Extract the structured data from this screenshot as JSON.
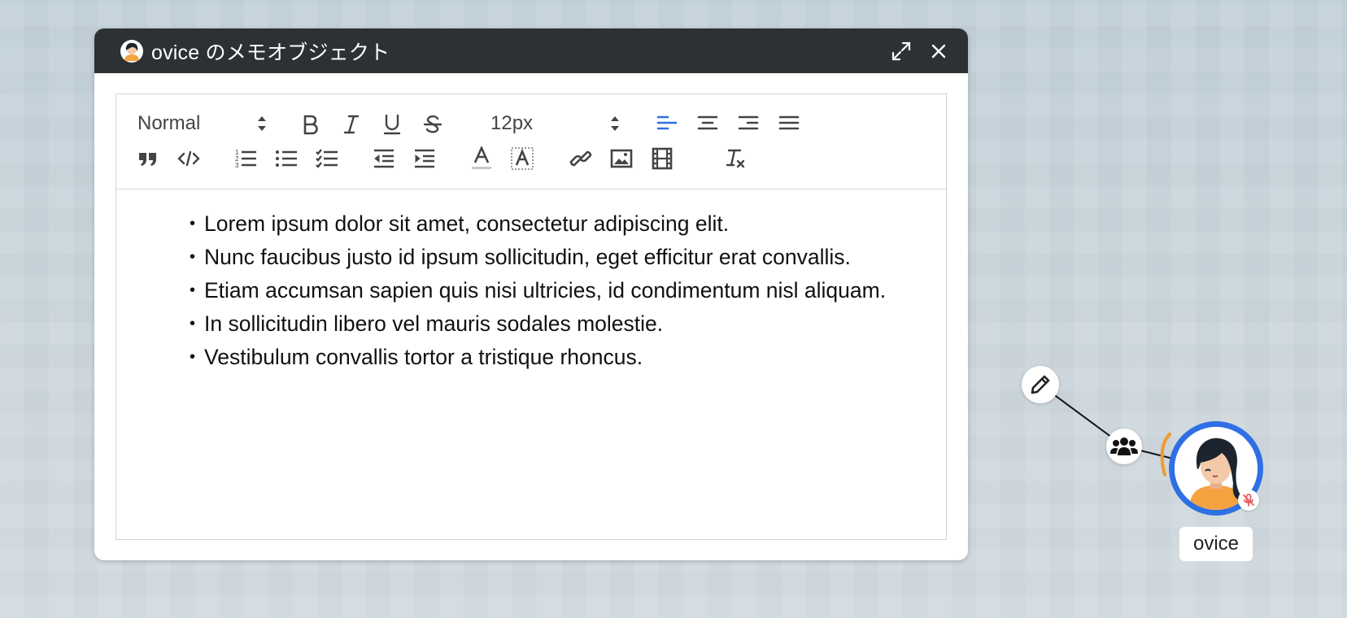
{
  "window": {
    "title": "ovice のメモオブジェクト",
    "title_icon": "avatar-icon",
    "expand_icon": "expand-icon",
    "close_icon": "close-icon"
  },
  "toolbar": {
    "heading_select": "Normal",
    "size_select": "12px",
    "row1_icons": [
      "bold-icon",
      "italic-icon",
      "underline-icon",
      "strike-icon",
      "align-left-icon",
      "align-center-icon",
      "align-right-icon",
      "align-justify-icon"
    ],
    "row2_icons": [
      "blockquote-icon",
      "code-icon",
      "ordered-list-icon",
      "bullet-list-icon",
      "check-list-icon",
      "outdent-icon",
      "indent-icon",
      "text-color-icon",
      "background-color-icon",
      "link-icon",
      "image-icon",
      "video-icon",
      "clear-format-icon"
    ],
    "active_color": "#2f6fe4"
  },
  "content": {
    "items": [
      "Lorem ipsum dolor sit amet, consectetur adipiscing elit.",
      "Nunc faucibus justo id ipsum sollicitudin, eget efficitur erat convallis.",
      "Etiam accumsan sapien quis nisi ultricies, id condimentum nisl aliquam.",
      "In sollicitudin libero vel mauris sodales molestie.",
      "Vestibulum convallis tortor a tristique rhoncus."
    ]
  },
  "user": {
    "name": "ovice",
    "ring_color": "#2f6fe4",
    "voice_color": "#f29a2e",
    "mic_state": "muted",
    "icons": [
      "pencil-icon",
      "group-icon",
      "mic-off-icon"
    ]
  }
}
